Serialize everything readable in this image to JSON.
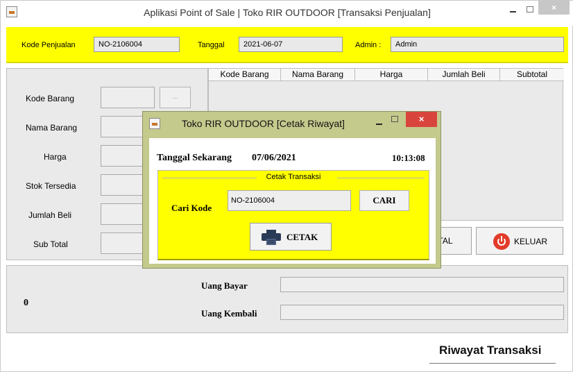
{
  "window": {
    "title": "Aplikasi Point of Sale | Toko RIR OUTDOOR [Transaksi Penjualan]",
    "close_symbol": "×",
    "icon": "java-cup-icon"
  },
  "header": {
    "kode_penjualan_label": "Kode Penjualan",
    "kode_penjualan_value": "NO-2106004",
    "tanggal_label": "Tanggal",
    "tanggal_value": "2021-06-07",
    "admin_label": "Admin :",
    "admin_value": "Admin",
    "bg_color": "#ffff00"
  },
  "form": {
    "kode_barang_label": "Kode Barang",
    "lookup_label": "...",
    "nama_barang_label": "Nama Barang",
    "harga_label": "Harga",
    "stok_label": "Stok Tersedia",
    "jumlah_beli_label": "Jumlah Beli",
    "sub_total_label": "Sub Total"
  },
  "table": {
    "columns": [
      "Kode Barang",
      "Nama Barang",
      "Harga",
      "Jumlah Beli",
      "Subtotal"
    ],
    "rows": []
  },
  "actions": {
    "total_label": "TAL",
    "keluar_label": "KELUAR",
    "keluar_icon": "power-icon"
  },
  "payment": {
    "total_value": "0",
    "uang_bayar_label": "Uang Bayar",
    "uang_bayar_value": "",
    "uang_kembali_label": "Uang Kembali",
    "uang_kembali_value": ""
  },
  "riwayat_label": "Riwayat Transaksi",
  "dialog": {
    "title": "Toko RIR OUTDOOR [Cetak Riwayat]",
    "close_symbol": "×",
    "tanggal_label": "Tanggal Sekarang",
    "tanggal_value": "07/06/2021",
    "time_value": "10:13:08",
    "group_title": "Cetak Transaksi",
    "cari_kode_label": "Cari Kode",
    "cari_kode_value": "NO-2106004",
    "cari_button": "CARI",
    "cetak_button": "CETAK",
    "cetak_icon": "printer-icon",
    "bg_color": "#c4c98c",
    "close_color": "#d9453c"
  }
}
